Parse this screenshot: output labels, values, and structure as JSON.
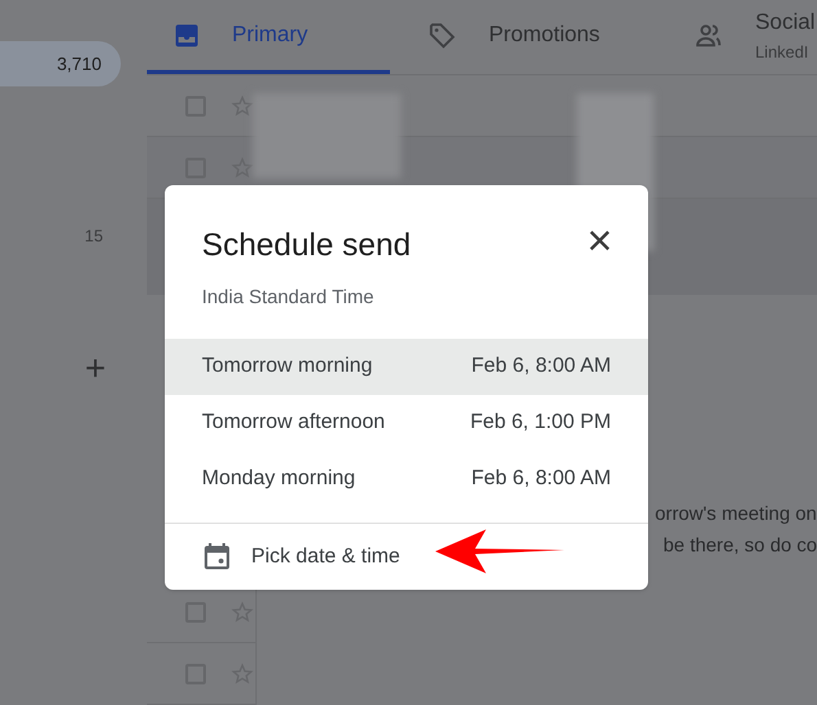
{
  "sidebar": {
    "inbox_count": "3,710",
    "count_2": "15",
    "add_label": "+"
  },
  "tabs": [
    {
      "label": "Primary",
      "kind": "inbox",
      "selected": true
    },
    {
      "label": "Promotions",
      "kind": "tag",
      "selected": false
    },
    {
      "label": "Social",
      "kind": "people",
      "subtitle": "LinkedI",
      "selected": false
    }
  ],
  "mail_rows": [
    {
      "checked": false
    },
    {
      "checked": false
    },
    {
      "checked": false
    },
    {
      "checked": false
    }
  ],
  "email_preview": [
    "orrow's meeting on",
    "be there, so do co"
  ],
  "dialog": {
    "title": "Schedule send",
    "close": "×",
    "timezone": "India Standard Time",
    "options": [
      {
        "label": "Tomorrow morning",
        "time": "Feb 6, 8:00 AM",
        "selected": true
      },
      {
        "label": "Tomorrow afternoon",
        "time": "Feb 6, 1:00 PM",
        "selected": false
      },
      {
        "label": "Monday morning",
        "time": "Feb 6, 8:00 AM",
        "selected": false
      }
    ],
    "pick": "Pick date & time"
  }
}
